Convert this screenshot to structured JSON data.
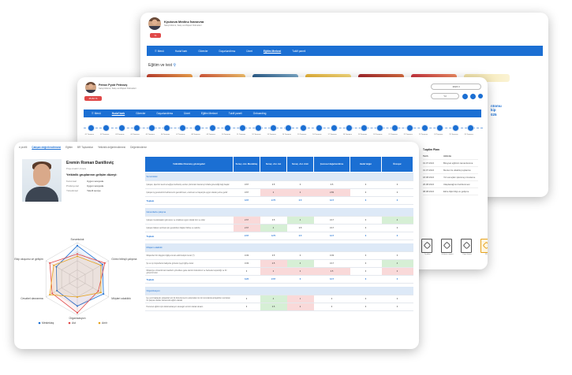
{
  "back_window": {
    "user_name": "Kyubova Medinə İvanovna",
    "user_role": "Satış bölümü, Satış və Müştəri Xidmətləri",
    "badge": "%",
    "nav": [
      "☰ Menü",
      "Hədəf kartı",
      "Görevler",
      "Dəyərləndirmə",
      "Ücret",
      "Eğitim Merkezi",
      "Təklif paneli"
    ],
    "nav_active": 5,
    "section_title": "Eğitim ve test",
    "cta": "ntomu\nkip\n025"
  },
  "mid_window": {
    "user_name": "Petrov Pyotr Petroviç",
    "user_role": "Satış bölümü, Satış və Müştəri Xidmətləri",
    "badge": "45.82 %",
    "year_select": "2024 il",
    "month_select": "Yıl",
    "nav": [
      "☰ Menü",
      "Hədəf kartı",
      "Görevler",
      "Dəyərləndirmə",
      "Ücret",
      "Eğitim Merkezi",
      "Təklif paneli",
      "Onboarding"
    ],
    "nav_active": 1,
    "timeline_labels": [
      "01 Temmuz",
      "02 Temmuz",
      "03 Temmuz",
      "04 Temmuz",
      "05 Temmuz",
      "06 Temmuz",
      "07 Temmuz",
      "08 Temmuz",
      "09 Temmuz",
      "10 Temmuz",
      "11 Temmuz",
      "12 Temmuz",
      "13 Temmuz",
      "14 Temmuz",
      "15 Temmuz",
      "16 Temmuz",
      "17 Temmuz",
      "18 Temmuz",
      "19 Temmuz",
      "20 Temmuz",
      "21 Temmuz",
      "22 Temmuz",
      "23 Temmuz",
      "24 Temmuz",
      "25 Temmuz",
      "26 Temmuz"
    ],
    "plan_title": "Təqdim Planı",
    "plan_head": [
      "Tarih",
      "Aktivite"
    ],
    "plan_rows": [
      [
        "01.07.2024",
        "Birəysel eğitimin tamamlanma"
      ],
      [
        "01.07.2024",
        "Mentor ile ulkablıq toplantısı"
      ],
      [
        "18.08.2024",
        "Yol sonuçları işlenmeyi inceleme"
      ],
      [
        "20.08.2024",
        "Ulaşılacağının belirlenmesi"
      ],
      [
        "08.08.2024",
        "Ekire ilişki bilgi ve gelişme"
      ]
    ],
    "files": [
      "İş planı",
      "Gelişme raporu",
      "Kayıt formu",
      "PDF"
    ]
  },
  "front_window": {
    "tabs": [
      "e profili",
      "Çalışan değerlendirmesi",
      "Eğitim",
      "BR Toplantılar",
      "Yetkinlik değerlendirmesi",
      "Değerlendirme"
    ],
    "tab_active": 1,
    "employee_name": "Eremin Roman Danilloviç",
    "employee_role": "Proje Analiz Uzmanı",
    "group_heading": "Yetkinlik gruplarının gelişim düzeyi:",
    "levels": [
      {
        "k": "Kurumsal",
        "v": "Uygun seviyede"
      },
      {
        "k": "Profesyonel",
        "v": "Uygun seviyede"
      },
      {
        "k": "Yönetimsel",
        "v": "Yeterli seviye"
      }
    ],
    "radar_axes": [
      "Sorumluluk",
      "Görev bilinçli çalışma",
      "Müşteri odaklılık",
      "Organizasyon",
      "Cevabel davranma",
      "Ekip oluşumu ve gelişim"
    ],
    "radar_legend": [
      "Meslektaş",
      "Ast",
      "Amir"
    ],
    "table_headers": [
      "Yetkinlikler\nDavranış göstergeleri",
      "Sonuç -Ast- Meslektaş",
      "Sonuç -Ast- Ast",
      "Sonuç -Ast- Amir",
      "Çevresel değerlendirme",
      "Hedef değer",
      "Önceyar"
    ],
    "sections": [
      {
        "title": "Sorumluluk",
        "rows": [
          {
            "d": "Çalışan, işlerinin kendi emeğiyle belirlemiş verilen çözümleri davranış hızlarla güvendiği bağı başlar",
            "v": [
              "3.67",
              "3.5",
              "3",
              "3.5",
              "3",
              "3"
            ],
            "c": [
              "",
              "",
              "",
              "",
              "",
              ""
            ]
          },
          {
            "d": "Çalışan iş gereksinimi belirlemenin gerektirmesi, ezelmesi ve başarıyla uygun olarak yerine getirir",
            "v": [
              "3.67",
              "2",
              "2",
              "2.83",
              "3",
              "3"
            ],
            "c": [
              "",
              "r",
              "r",
              "r",
              "",
              ""
            ]
          }
        ],
        "total": [
          "3.67",
          "2.75",
          "2.5",
          "3.17",
          "3",
          "3"
        ]
      },
      {
        "title": "Güvenilerle çalışma",
        "rows": [
          {
            "d": "Çalışan meslektaşları görevlere ve ortaklıça uygun olarak tüm ve oider",
            "v": [
              "2.67",
              "3.5",
              "4",
              "3.17",
              "3",
              "4"
            ],
            "c": [
              "r",
              "",
              "g",
              "",
              "",
              "g"
            ]
          },
          {
            "d": "Çalışan ifadesi verilmek için gerektirilen bilgileri bilirse ve sabırla",
            "v": [
              "2.67",
              "4",
              "3.5",
              "3.17",
              "3",
              "3"
            ],
            "c": [
              "r",
              "g",
              "",
              "",
              "",
              ""
            ]
          }
        ],
        "total": [
          "2.67",
          "3.75",
          "3.5",
          "3.17",
          "3",
          "3"
        ]
      },
      {
        "title": "Müşteri odaklılık",
        "rows": [
          {
            "d": "Müşterileri bir düşgücü ilgiliye kuran etkili iletişim kurar (?)",
            "v": [
              "3.33",
              "3.5",
              "3",
              "3.33",
              "3",
              "3"
            ],
            "c": [
              "",
              "",
              "",
              "",
              "",
              ""
            ]
          },
          {
            "d": "Şu ve iş müşterilerle faaliyette gözede üyeyi ilgiliye kurar",
            "v": [
              "3.33",
              "2.5",
              "4",
              "3.17",
              "3",
              "4"
            ],
            "c": [
              "",
              "r",
              "g",
              "",
              "",
              "g"
            ]
          },
          {
            "d": "Müşteriye uzmanlık tam kaeflerin yöneltlere geke dersini bulundurur ve herkesle kuçandığı ve bir görecini bulur",
            "v": [
              "3",
              "2",
              "2",
              "2.5",
              "3",
              "2"
            ],
            "c": [
              "",
              "r",
              "r",
              "r",
              "",
              "r"
            ]
          }
        ],
        "total": [
          "3.22",
          "2.67",
          "3",
          "3.17",
          "3",
          "3"
        ]
      },
      {
        "title": "Organizasyon",
        "rows": [
          {
            "d": "İşe yeni başlayan çalışanlar için iki düzenlemenin çalışmaları ile tüm konularda anlayabilen sonlanan bir parçası olarak zamanında eğitim olaraki",
            "v": [
              "3",
              "4",
              "1",
              "3",
              "3",
              "3"
            ],
            "c": [
              "",
              "g",
              "r",
              "",
              "",
              ""
            ]
          },
          {
            "d": "Personel eğitimi için dokümantasyon destegini etmimi olarak devam",
            "v": [
              "3",
              "3.5",
              "2",
              "3",
              "3",
              "3"
            ],
            "c": [
              "",
              "g",
              "r",
              "",
              "",
              ""
            ]
          }
        ],
        "total": null
      }
    ],
    "total_label": "Toplam"
  },
  "colors": {
    "nav_blue": "#1b6fd3",
    "low": "#f9d9d9",
    "high": "#d6efd5",
    "badge_red": "#e04848",
    "series": [
      "#1b6fd3",
      "#e04848",
      "#e5a21c"
    ]
  },
  "radar_series": [
    {
      "name": "Meslektaş",
      "values": [
        3.67,
        3.2,
        3.33,
        3,
        2.6,
        2.67
      ]
    },
    {
      "name": "Ast",
      "values": [
        2.75,
        3.5,
        2.67,
        3.75,
        3.2,
        3.5
      ]
    },
    {
      "name": "Amir",
      "values": [
        2.5,
        3.0,
        3,
        2,
        3.5,
        3.0
      ]
    }
  ]
}
